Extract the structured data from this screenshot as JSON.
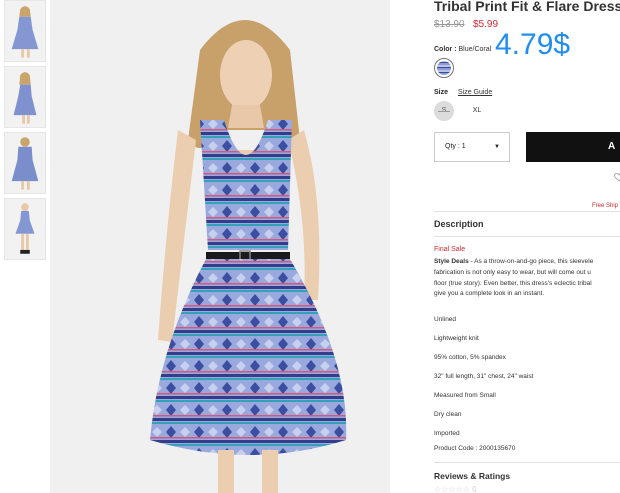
{
  "product": {
    "title": "Tribal Print Fit & Flare Dress",
    "price_original": "$13.90",
    "price_sale": "$5.99",
    "overlay_price": "4.79$"
  },
  "color": {
    "label": "Color :",
    "value": "Blue/Coral"
  },
  "size": {
    "label": "Size",
    "guide_link": "Size Guide",
    "options": [
      "S",
      "XL"
    ]
  },
  "purchase": {
    "qty_label": "Qty : 1",
    "add_button_label": "A",
    "free_shipping": "Free Ship"
  },
  "description": {
    "heading": "Description",
    "final_sale": "Final Sale",
    "style_deals_label": "Style Deals",
    "lines": [
      " - As a throw-on-and-go piece, this sleevele",
      "fabrication is not only easy to wear, but will come out u",
      "floor (true story). Even better, this dress's eclectic tribal",
      "give you a complete look in an instant."
    ],
    "specs": [
      "Unlined",
      "Lightweight knit",
      "95% cotton, 5% spandex",
      "32\" full length, 31\" chest, 24\" waist",
      "Measured from Small",
      "Dry clean",
      "Imported",
      "Product Code : 2000135670"
    ]
  },
  "reviews": {
    "heading": "Reviews & Ratings",
    "stars": "☆☆☆☆☆",
    "count": "0"
  },
  "colors": {
    "sale_red": "#d0282e",
    "overlay_blue": "#1e8ef1",
    "button_black": "#111111"
  }
}
